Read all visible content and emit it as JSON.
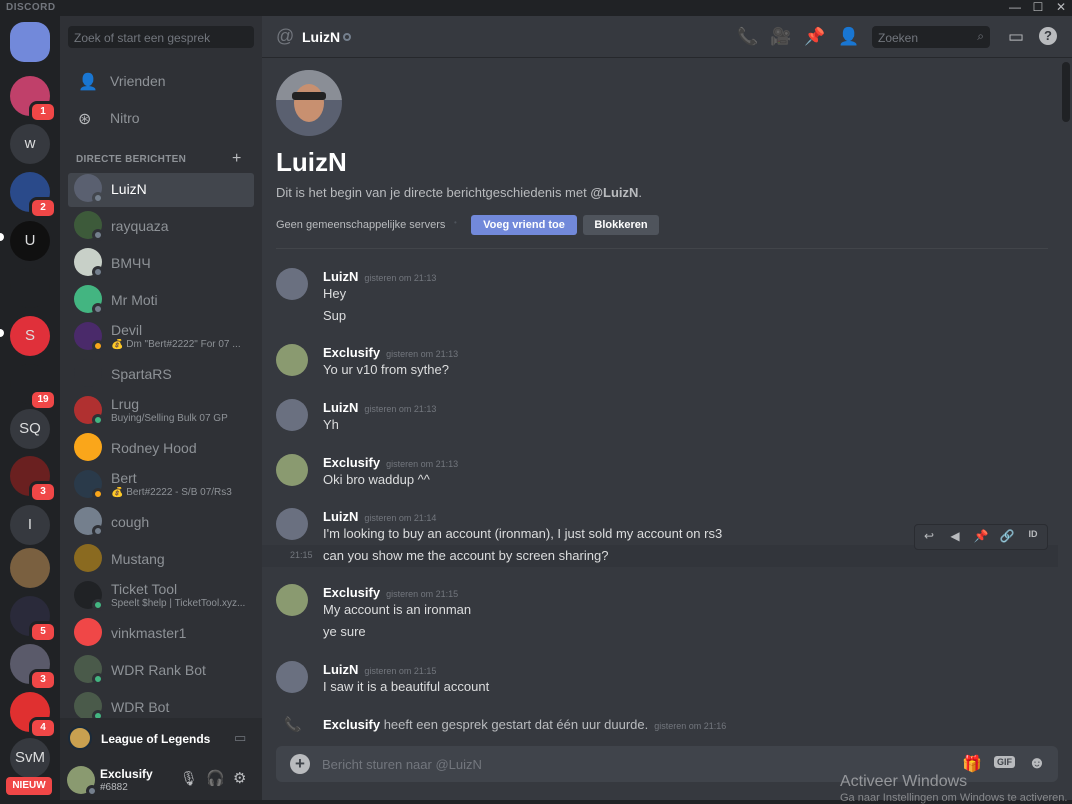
{
  "app": {
    "brand": "DISCORD",
    "window_controls": [
      "—",
      "☐",
      "✕"
    ]
  },
  "guilds": [
    {
      "name": "home",
      "label": "",
      "badge": ""
    },
    {
      "name": "server-1",
      "label": "",
      "badge": "1"
    },
    {
      "name": "server-w",
      "label": "w",
      "badge": ""
    },
    {
      "name": "server-3",
      "label": "",
      "badge": "2"
    },
    {
      "name": "server-4",
      "label": "U",
      "badge": ""
    },
    {
      "name": "server-5",
      "label": "",
      "badge": ""
    },
    {
      "name": "server-6",
      "label": "S",
      "badge": ""
    },
    {
      "name": "server-7",
      "label": "",
      "badge": "19"
    },
    {
      "name": "server-sq",
      "label": "SQ",
      "badge": ""
    },
    {
      "name": "server-9",
      "label": "",
      "badge": "3"
    },
    {
      "name": "server-i",
      "label": "I",
      "badge": ""
    },
    {
      "name": "server-11",
      "label": "",
      "badge": ""
    },
    {
      "name": "server-12",
      "label": "",
      "badge": "5"
    },
    {
      "name": "server-13",
      "label": "",
      "badge": "3"
    },
    {
      "name": "server-14",
      "label": "",
      "badge": "4"
    },
    {
      "name": "server-svm",
      "label": "SvM",
      "badge": ""
    }
  ],
  "guild_new_label": "NIEUW",
  "dm_sidebar": {
    "search_placeholder": "Zoek of start een gesprek",
    "nav": [
      {
        "label": "Vrienden",
        "icon": "friends-icon"
      },
      {
        "label": "Nitro",
        "icon": "nitro-icon"
      }
    ],
    "header": "DIRECTE BERICHTEN",
    "dms": [
      {
        "name": "LuizN",
        "sub": "",
        "status": "offline",
        "color": "#5a6070",
        "selected": true
      },
      {
        "name": "rayquaza",
        "sub": "",
        "status": "offline",
        "color": "#3d5a3a"
      },
      {
        "name": "BMЧЧ",
        "sub": "",
        "status": "offline",
        "color": "#c8d0c8"
      },
      {
        "name": "Mr Moti",
        "sub": "",
        "status": "offline",
        "color": "#43b581"
      },
      {
        "name": "Devil",
        "sub": "💰 Dm \"Bert#2222\" For 07 ...",
        "status": "idle",
        "color": "#4a2a6a"
      },
      {
        "name": "SpartaRS",
        "sub": "",
        "status": "none",
        "color": "#2f3136"
      },
      {
        "name": "Lrug",
        "sub": "Buying/Selling Bulk 07 GP",
        "status": "online",
        "color": "#b03030"
      },
      {
        "name": "Rodney Hood",
        "sub": "",
        "status": "none",
        "color": "#faa61a"
      },
      {
        "name": "Bert",
        "sub": "💰 Bert#2222 - S/B 07/Rs3",
        "status": "idle",
        "color": "#2a3a4a"
      },
      {
        "name": "cough",
        "sub": "",
        "status": "offline",
        "color": "#747f8d"
      },
      {
        "name": "Mustang",
        "sub": "",
        "status": "none",
        "color": "#8a6a20"
      },
      {
        "name": "Ticket Tool",
        "sub": "Speelt $help | TicketTool.xyz...",
        "status": "online",
        "color": "#202225"
      },
      {
        "name": "vinkmaster1",
        "sub": "",
        "status": "none",
        "color": "#f04747"
      },
      {
        "name": "WDR Rank Bot",
        "sub": "",
        "status": "online",
        "color": "#4a5a4a"
      },
      {
        "name": "WDR Bot",
        "sub": "",
        "status": "online",
        "color": "#4a5a4a"
      }
    ],
    "activity": {
      "game": "League of Legends"
    },
    "user": {
      "name": "Exclusify",
      "tag": "#6882"
    }
  },
  "header": {
    "channel": "LuizN",
    "search_placeholder": "Zoeken"
  },
  "intro": {
    "name": "LuizN",
    "text_prefix": "Dit is het begin van je directe berichtgeschiedenis met ",
    "mention": "@LuizN",
    "text_suffix": ".",
    "mutual": "Geen gemeenschappelijke servers",
    "add_friend": "Voeg vriend toe",
    "block": "Blokkeren"
  },
  "messages": [
    {
      "author": "LuizN",
      "time": "gisteren om 21:13",
      "lines": [
        "Hey",
        "Sup"
      ]
    },
    {
      "author": "Exclusify",
      "time": "gisteren om 21:13",
      "lines": [
        "Yo ur v10 from sythe?"
      ]
    },
    {
      "author": "LuizN",
      "time": "gisteren om 21:13",
      "lines": [
        "Yh"
      ]
    },
    {
      "author": "Exclusify",
      "time": "gisteren om 21:13",
      "lines": [
        "Oki bro waddup ^^"
      ]
    },
    {
      "author": "LuizN",
      "time": "gisteren om 21:14",
      "lines": [
        "I'm looking to buy an account (ironman), I just sold my account on rs3",
        "can you show me the account by screen sharing?"
      ],
      "hover_time": "21:15"
    },
    {
      "author": "Exclusify",
      "time": "gisteren om 21:15",
      "lines": [
        "My account is an ironman",
        "ye sure"
      ]
    },
    {
      "author": "LuizN",
      "time": "gisteren om 21:15",
      "lines": [
        "I saw it is a beautiful account"
      ]
    }
  ],
  "call_event": {
    "author": "Exclusify",
    "text": " heeft een gesprek gestart dat één uur duurde.",
    "time": "gisteren om 21:16"
  },
  "composer": {
    "placeholder": "Bericht sturen naar @LuizN"
  },
  "watermark": {
    "title": "Activeer Windows",
    "sub": "Ga naar Instellingen om Windows te activeren."
  },
  "colors": {
    "blurple": "#7289da",
    "online": "#43b581",
    "idle": "#faa61a",
    "offline": "#747f8d",
    "danger": "#f04747"
  }
}
